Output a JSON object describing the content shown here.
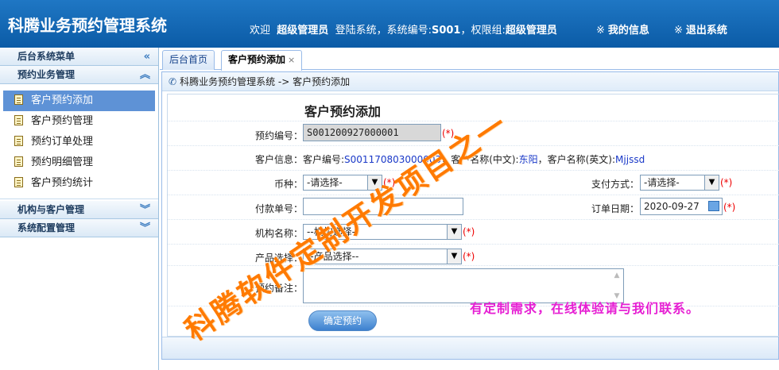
{
  "header": {
    "app_title": "科腾业务预约管理系统",
    "welcome_prefix": "欢迎",
    "user_name": "超级管理员",
    "login_text": "登陆系统，系统编号:",
    "system_no": "S001",
    "role_text": "，权限组:",
    "role_name": "超级管理员",
    "my_info": "我的信息",
    "logout": "退出系统",
    "link_mark": "※"
  },
  "sidebar": {
    "menu_title": "后台系统菜单",
    "groups": [
      {
        "label": "预约业务管理",
        "items": [
          {
            "label": "客户预约添加",
            "active": true
          },
          {
            "label": "客户预约管理"
          },
          {
            "label": "预约订单处理"
          },
          {
            "label": "预约明细管理"
          },
          {
            "label": "客户预约统计"
          }
        ]
      },
      {
        "label": "机构与客户管理"
      },
      {
        "label": "系统配置管理"
      }
    ]
  },
  "tabs": [
    {
      "label": "后台首页"
    },
    {
      "label": "客户预约添加",
      "active": true,
      "close": "×"
    }
  ],
  "breadcrumb": "科腾业务预约管理系统 -> 客户预约添加",
  "form": {
    "title": "客户预约添加",
    "order_no_label": "预约编号：",
    "order_no_value": "S001200927000001",
    "required_mark": "(*)",
    "customer_info_label": "客户信息：客户编号:",
    "customer_no": "S001170803000003",
    "cn_name_label": "，客户名称(中文):",
    "cn_name": "东阳",
    "en_name_label": "，客户名称(英文):",
    "en_name": "Mjjssd",
    "currency_label": "币种：",
    "currency_value": "-请选择-",
    "pay_method_label": "支付方式：",
    "pay_method_value": "-请选择-",
    "payment_no_label": "付款单号：",
    "payment_no_value": "",
    "order_date_label": "订单日期：",
    "order_date_value": "2020-09-27",
    "org_label": "机构名称：",
    "org_value": "--机构选择--",
    "product_label": "产品选择：",
    "product_value": "--产品选择--",
    "remark_label": "预约备注：",
    "remark_value": "",
    "submit": "确定预约"
  },
  "promo": "有定制需求，在线体验请与我们联系。",
  "watermark": "科腾软件定制开发项目之一"
}
